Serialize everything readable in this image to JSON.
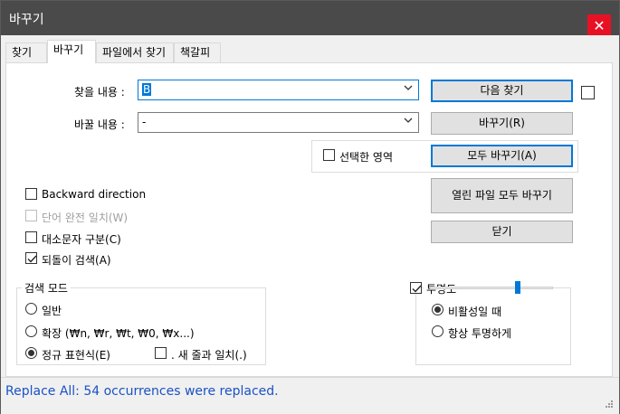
{
  "window": {
    "title": "바꾸기",
    "close_glyph": "✕"
  },
  "tabs": [
    {
      "label": "찾기",
      "active": false
    },
    {
      "label": "바꾸기",
      "active": true
    },
    {
      "label": "파일에서 찾기",
      "active": false
    },
    {
      "label": "책갈피",
      "active": false
    }
  ],
  "find": {
    "label": "찾을 내용 :",
    "value": "B"
  },
  "replace": {
    "label": "바꿀 내용 :",
    "value": "-"
  },
  "buttons": {
    "find_next": "다음 찾기",
    "replace": "바꾸기(R)",
    "replace_all": "모두 바꾸기(A)",
    "replace_all_open": "열린 파일 모두 바꾸기",
    "close": "닫기"
  },
  "selection_only": {
    "label": "선택한 영역",
    "checked": false
  },
  "options": {
    "backward": {
      "label": "Backward direction",
      "checked": false
    },
    "whole_word": {
      "label": "단어 완전 일치(W)",
      "checked": false,
      "disabled": true
    },
    "match_case": {
      "label": "대소문자 구분(C)",
      "checked": false
    },
    "wrap_around": {
      "label": "되돌이 검색(A)",
      "checked": true
    }
  },
  "search_mode": {
    "title": "검색 모드",
    "normal": "일반",
    "extended": "확장 (₩n, ₩r, ₩t, ₩0, ₩x...)",
    "regex": "정규 표현식(E)",
    "selected": "regex",
    "dot_newline": {
      "label": ". 새 줄과 일치(.)",
      "checked": false
    }
  },
  "transparency": {
    "title": "투명도",
    "enabled": true,
    "on_lose_focus": "비활성일 때",
    "always": "항상 투명하게",
    "selected": "on_lose_focus",
    "level": 0.71
  },
  "status": {
    "message": "Replace All: 54 occurrences were replaced."
  }
}
